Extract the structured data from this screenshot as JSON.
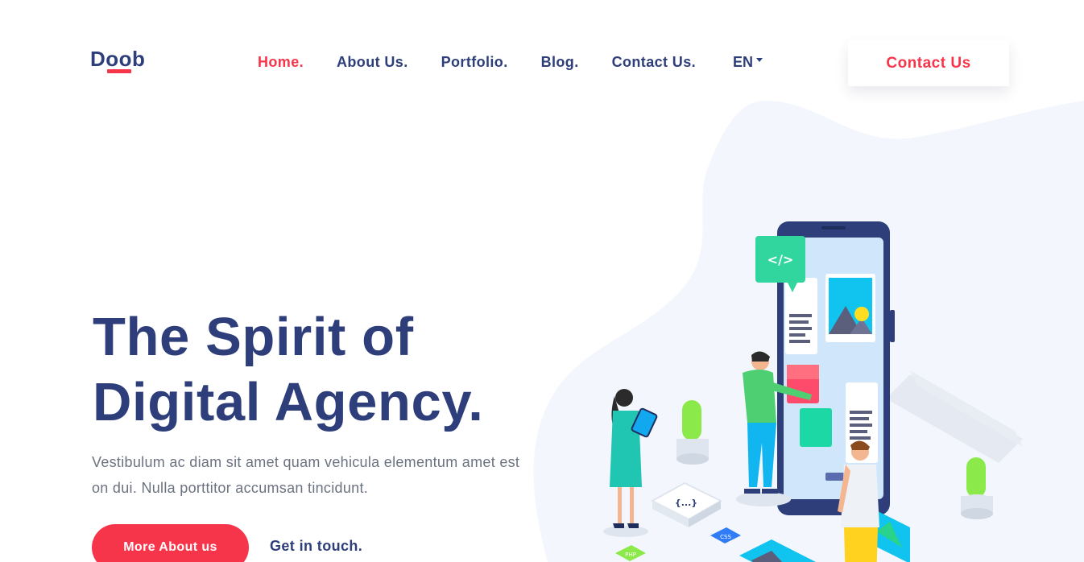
{
  "header": {
    "logo": "Doob",
    "nav": [
      "Home.",
      "About Us.",
      "Portfolio.",
      "Blog.",
      "Contact Us."
    ],
    "active_nav": "Home.",
    "language": "EN",
    "cta_label": "Contact Us"
  },
  "hero": {
    "title_line1": "The Spirit of",
    "title_line2": "Digital Agency.",
    "description": "Vestibulum ac diam sit amet quam vehicula elementum amet est on dui. Nulla porttitor accumsan tincidunt.",
    "primary_button": "More About us",
    "secondary_link": "Get in touch."
  },
  "illustration": {
    "code_bubble": "</>",
    "braces_block": "{...}",
    "css_tag": "CSS",
    "php_tag": "PHP"
  },
  "colors": {
    "brand_navy": "#2d3e7a",
    "accent_red": "#f7354a",
    "blob_bg": "#f3f7fd",
    "muted_text": "#6b7280"
  }
}
